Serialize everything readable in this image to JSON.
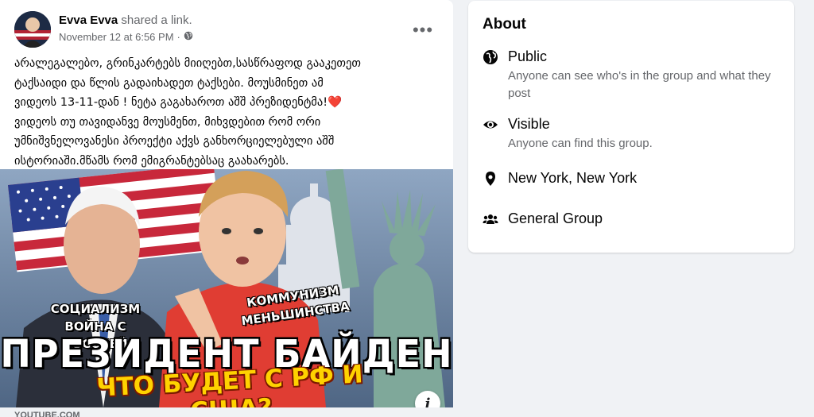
{
  "post": {
    "author": "Evva Evva",
    "action": " shared a link.",
    "timestamp": "November 12 at 6:56 PM",
    "separator": "·",
    "privacy_icon": "globe-icon",
    "more_label": "•••",
    "text_before_heart": "არალეგალებო, გრინკარტებს მიიღებთ,სასწრაფოდ გააკეთეთ\nტაქსაიდი და წლის გადაიხადეთ ტაქსები. მოუსმინეთ ამ\nვიდეოს 13-11-დან ! ნეტა გაგახაროთ აშშ პრეზიდენტმა!",
    "heart": "❤️",
    "text_after_heart": "\nვიდეოს თუ თავიდანვე მოუსმენთ, მიხვდებით რომ ორი\nუმნიშვნელოვანესი პროექტი აქვს განხორციელებული აშშ\nისტორიაში.მწამს რომ ემიგრანტებსაც გაახარებს.",
    "image": {
      "label_left": "СОЦИАЛИЗМ\nВОЙНА С РОССИЕЙ",
      "label_right": "КОММУНИЗМ\nМЕНЬШИНСТВА",
      "headline": "ПРЕЗИДЕНТ БАЙДЕН",
      "subheadline": "ЧТО БУДЕТ С РФ И США?",
      "info_label": "i"
    },
    "link_domain_partial": "YOUTUBE.COM"
  },
  "about": {
    "title": "About",
    "rows": [
      {
        "icon": "globe-icon",
        "title": "Public",
        "desc": "Anyone can see who's in the group and what they post"
      },
      {
        "icon": "eye-icon",
        "title": "Visible",
        "desc": "Anyone can find this group."
      },
      {
        "icon": "location-pin-icon",
        "title": "New York, New York",
        "desc": ""
      },
      {
        "icon": "people-icon",
        "title": "General Group",
        "desc": ""
      }
    ]
  },
  "colors": {
    "background": "#f0f2f5",
    "secondary_text": "#65676b",
    "heart": "#e0245e",
    "banner_yellow": "#ffd200"
  }
}
